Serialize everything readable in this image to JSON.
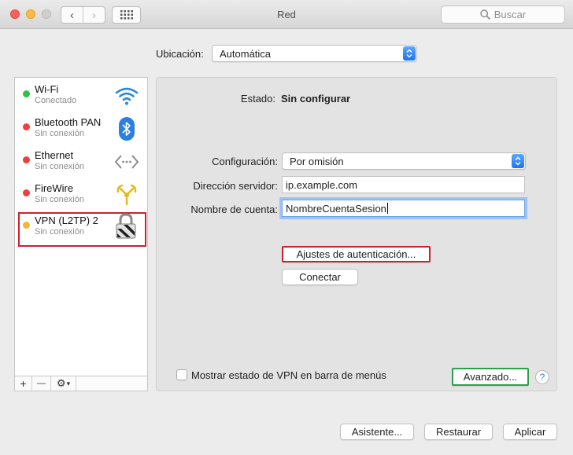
{
  "window": {
    "title": "Red",
    "search_placeholder": "Buscar",
    "nav_back_glyph": "‹",
    "nav_forward_glyph": "›"
  },
  "location": {
    "label": "Ubicación:",
    "value": "Automática"
  },
  "services": [
    {
      "name": "Wi-Fi",
      "status": "Conectado",
      "dot_color": "#2fc23f",
      "icon": "wifi-icon"
    },
    {
      "name": "Bluetooth PAN",
      "status": "Sin conexión",
      "dot_color": "#ee3e3c",
      "icon": "bluetooth-icon"
    },
    {
      "name": "Ethernet",
      "status": "Sin conexión",
      "dot_color": "#ee3e3c",
      "icon": "ethernet-icon"
    },
    {
      "name": "FireWire",
      "status": "Sin conexión",
      "dot_color": "#ee3e3c",
      "icon": "firewire-icon"
    },
    {
      "name": "VPN (L2TP) 2",
      "status": "Sin conexión",
      "dot_color": "#f5b73a",
      "icon": "vpn-lock-icon",
      "selected": true
    }
  ],
  "sidebar_tools": {
    "add": "+",
    "remove": "—",
    "gear": "⚙",
    "chevron": "▾"
  },
  "detail": {
    "status_label": "Estado:",
    "status_value": "Sin configurar",
    "config_label": "Configuración:",
    "config_value": "Por omisión",
    "server_label": "Dirección servidor:",
    "server_value": "ip.example.com",
    "account_label": "Nombre de cuenta:",
    "account_value": "NombreCuentaSesion",
    "auth_button": "Ajustes de autenticación...",
    "connect_button": "Conectar",
    "show_vpn_label": "Mostrar estado de VPN en barra de menús",
    "advanced_button": "Avanzado...",
    "help_glyph": "?"
  },
  "footer": {
    "assistant_button": "Asistente...",
    "revert_button": "Restaurar",
    "apply_button": "Aplicar"
  }
}
